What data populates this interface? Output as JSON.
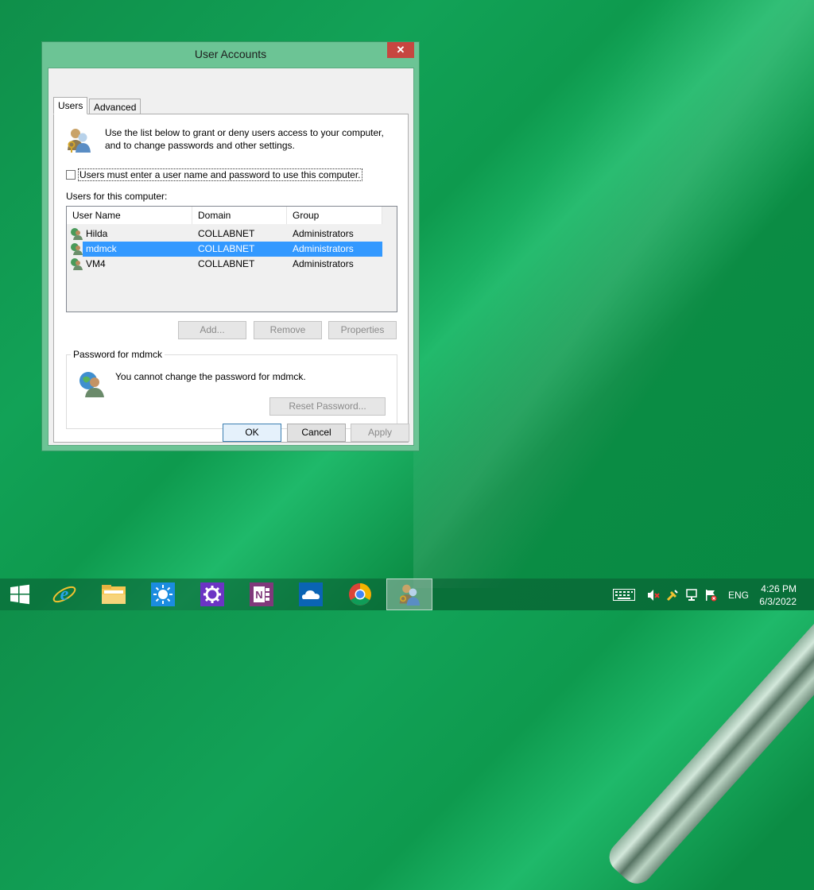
{
  "window": {
    "title": "User Accounts",
    "close_glyph": "✕"
  },
  "tabs": [
    {
      "label": "Users",
      "active": true
    },
    {
      "label": "Advanced",
      "active": false
    }
  ],
  "intro_text": "Use the list below to grant or deny users access to your computer, and to change passwords and other settings.",
  "require_login": {
    "label": "Users must enter a user name and password to use this computer.",
    "checked": false
  },
  "users_section_label": "Users for this computer:",
  "user_list": {
    "columns": [
      "User Name",
      "Domain",
      "Group"
    ],
    "rows": [
      {
        "user": "Hilda",
        "domain": "COLLABNET",
        "group": "Administrators",
        "selected": false
      },
      {
        "user": "mdmck",
        "domain": "COLLABNET",
        "group": "Administrators",
        "selected": true
      },
      {
        "user": "VM4",
        "domain": "COLLABNET",
        "group": "Administrators",
        "selected": false
      }
    ]
  },
  "list_buttons": {
    "add": "Add...",
    "remove": "Remove",
    "properties": "Properties"
  },
  "password_group": {
    "title": "Password for mdmck",
    "message": "You cannot change the password for mdmck.",
    "reset_button": "Reset Password..."
  },
  "dialog_buttons": {
    "ok": "OK",
    "cancel": "Cancel",
    "apply": "Apply"
  },
  "taskbar": {
    "apps": [
      "start-icon",
      "internet-explorer-icon",
      "file-explorer-icon",
      "weather-icon",
      "settings-icon",
      "onenote-icon",
      "onedrive-icon",
      "chrome-icon",
      "user-accounts-icon"
    ],
    "language": "ENG",
    "time": "4:26 PM",
    "date": "6/3/2022"
  },
  "colors": {
    "window_frame": "#6cc495",
    "close_button": "#c74640",
    "selection": "#3399ff",
    "desktop": "#12a257"
  }
}
